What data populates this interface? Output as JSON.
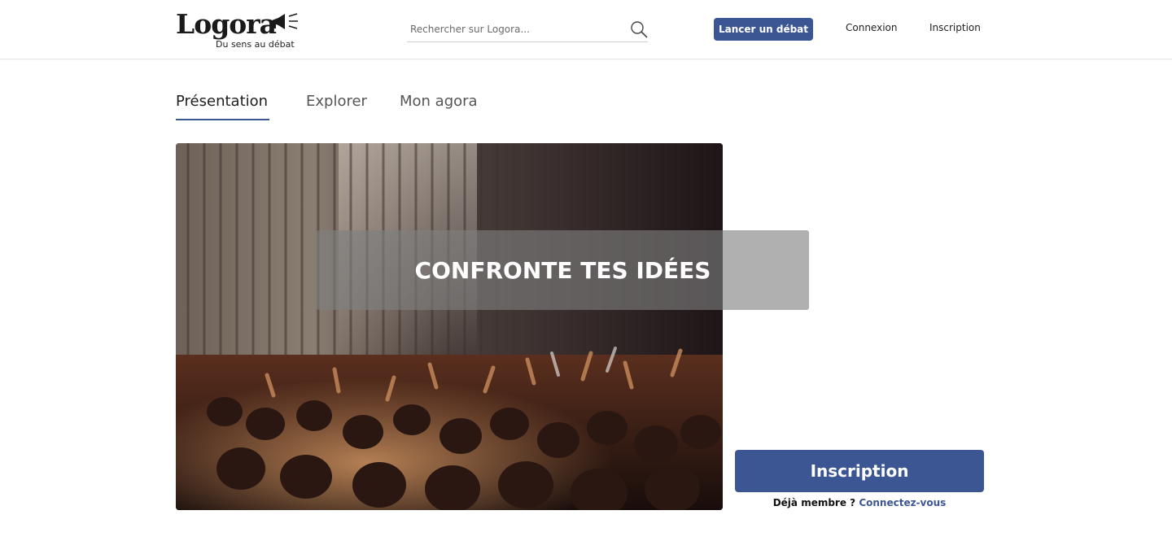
{
  "header": {
    "logo": {
      "name": "Logora",
      "tagline": "Du sens au débat"
    },
    "search": {
      "placeholder": "Rechercher sur Logora..."
    },
    "launch_debate_label": "Lancer un débat",
    "login_label": "Connexion",
    "signup_label": "Inscription"
  },
  "tabs": [
    {
      "label": "Présentation",
      "active": true
    },
    {
      "label": "Explorer",
      "active": false
    },
    {
      "label": "Mon agora",
      "active": false
    }
  ],
  "hero": {
    "title": "CONFRONTE TES IDÉES"
  },
  "signup_panel": {
    "button_label": "Inscription",
    "already_member_text": "Déjà membre ?",
    "login_link_label": "Connectez-vous"
  },
  "colors": {
    "primary": "#3c5593",
    "banner_overlay": "rgba(128,128,128,0.62)"
  },
  "icons": [
    "megaphone-icon",
    "search-icon"
  ]
}
